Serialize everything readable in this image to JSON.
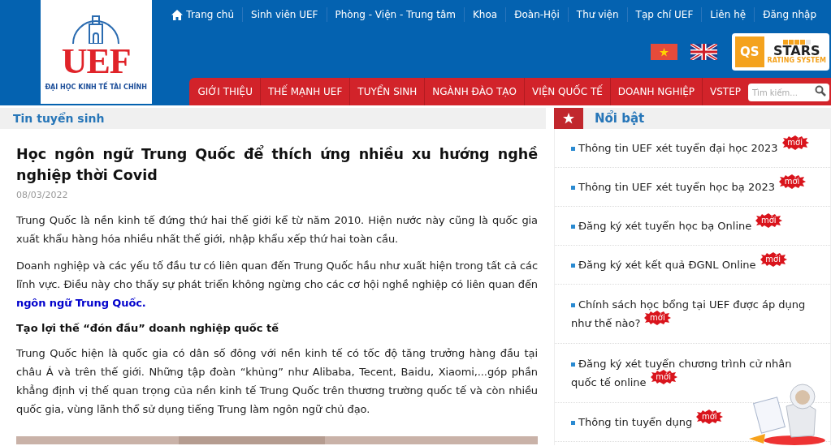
{
  "logo": {
    "wordmark": "UEF",
    "subtitle": "ĐẠI HỌC KINH TẾ TÀI CHÍNH"
  },
  "top_nav": [
    {
      "label": "Trang chủ",
      "kind": "home"
    },
    {
      "label": "Sinh viên UEF",
      "kind": "link"
    },
    {
      "label": "Phòng - Viện - Trung tâm",
      "kind": "link"
    },
    {
      "label": "Khoa",
      "kind": "link"
    },
    {
      "label": "Đoàn-Hội",
      "kind": "link"
    },
    {
      "label": "Thư viện",
      "kind": "link"
    },
    {
      "label": "Tạp chí UEF",
      "kind": "link"
    },
    {
      "label": "Liên hệ",
      "kind": "link"
    },
    {
      "label": "Đăng nhập",
      "kind": "link"
    }
  ],
  "qs_badge": {
    "mark": "QS",
    "title": "STARS",
    "subtitle": "RATING SYSTEM",
    "stars": 4
  },
  "main_menu": [
    "GIỚI THIỆU",
    "THẾ MẠNH UEF",
    "TUYỂN SINH",
    "NGÀNH ĐÀO TẠO",
    "VIỆN QUỐC TẾ",
    "DOANH NGHIỆP",
    "VSTEP"
  ],
  "search": {
    "placeholder": "Tìm kiếm..."
  },
  "section_title": "Tin tuyển sinh",
  "article": {
    "title": "Học ngôn ngữ Trung Quốc để thích ứng nhiều xu hướng nghề nghiệp thời Covid",
    "date": "08/03/2022",
    "blocks": [
      {
        "kind": "paragraph",
        "text": "Trung Quốc là nền kinh tế đứng thứ hai thế giới kể từ năm 2010. Hiện nước này cũng là quốc gia xuất khẩu hàng hóa nhiều nhất thế giới, nhập khẩu xếp thứ hai toàn cầu."
      },
      {
        "kind": "paragraph",
        "text": "Doanh nghiệp và các yếu tố đầu tư có liên quan đến Trung Quốc hầu như xuất hiện trong tất cả các lĩnh vực. Điều này cho thấy sự phát triển không ngừng cho các cơ hội nghề nghiệp có liên quan đến",
        "link": "ngôn ngữ Trung Quốc."
      },
      {
        "kind": "heading",
        "text": "Tạo lợi thế “đón đầu” doanh nghiệp quốc tế"
      },
      {
        "kind": "paragraph",
        "text": "Trung Quốc hiện là quốc gia có dân số đông với nền kinh tế có tốc độ tăng trưởng hàng đầu tại châu Á và trên thế giới. Những tập đoàn “khủng” như Alibaba, Tecent, Baidu, Xiaomi,...góp phần khẳng định vị thế quan trọng của nền kinh tế Trung Quốc trên thương trường quốc tế và còn nhiều quốc gia, vùng lãnh thổ sử dụng tiếng Trung làm ngôn ngữ chủ đạo."
      }
    ]
  },
  "featured": {
    "title": "Nổi bật",
    "items": [
      {
        "text": "Thông tin UEF xét tuyển đại học 2023",
        "badge": "mới"
      },
      {
        "text": "Thông tin UEF xét tuyển học bạ 2023",
        "badge": "mới"
      },
      {
        "text": "Đăng ký xét tuyển học bạ Online",
        "badge": "mới"
      },
      {
        "text": "Đăng ký xét kết quả ĐGNL Online",
        "badge": "mới"
      },
      {
        "text": "Chính sách học bổng tại UEF được áp dụng như thế nào?",
        "badge": "mới"
      },
      {
        "text": "Đăng ký xét tuyển chương trình cử nhân quốc tế online",
        "badge": "mới"
      },
      {
        "text": "Thông tin tuyển dụng",
        "badge": "mới"
      }
    ]
  }
}
